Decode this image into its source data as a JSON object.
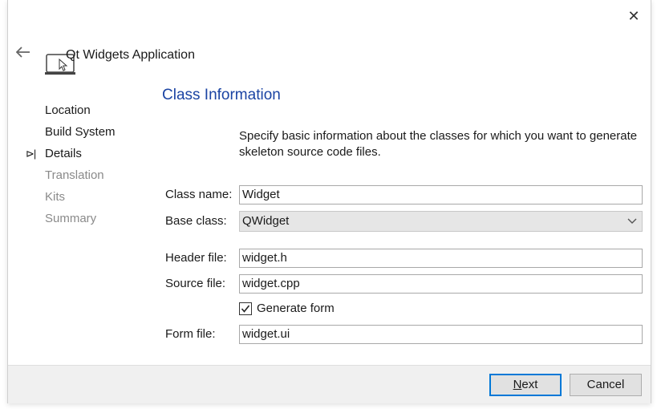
{
  "window": {
    "title": "Qt Widgets Application",
    "close_icon": "close-icon",
    "back_icon": "back-arrow-icon",
    "app_icon": "qt-widgets-app-icon"
  },
  "steps": [
    {
      "label": "Location",
      "state": "done"
    },
    {
      "label": "Build System",
      "state": "done"
    },
    {
      "label": "Details",
      "state": "current"
    },
    {
      "label": "Translation",
      "state": "pending"
    },
    {
      "label": "Kits",
      "state": "pending"
    },
    {
      "label": "Summary",
      "state": "pending"
    }
  ],
  "current_marker": "⊳|",
  "section": {
    "title": "Class Information",
    "description": "Specify basic information about the classes for which you want to generate skeleton source code files."
  },
  "form": {
    "class_name_label": "Class name:",
    "class_name_value": "Widget",
    "base_class_label": "Base class:",
    "base_class_value": "QWidget",
    "header_file_label": "Header file:",
    "header_file_value": "widget.h",
    "source_file_label": "Source file:",
    "source_file_value": "widget.cpp",
    "generate_form_label": "Generate form",
    "generate_form_checked": true,
    "form_file_label": "Form file:",
    "form_file_value": "widget.ui"
  },
  "buttons": {
    "next_mnemonic": "N",
    "next_rest": "ext",
    "cancel": "Cancel"
  },
  "colors": {
    "accent": "#1b44a3",
    "focus_border": "#0078d7",
    "disabled_text": "#8a8a8a"
  }
}
